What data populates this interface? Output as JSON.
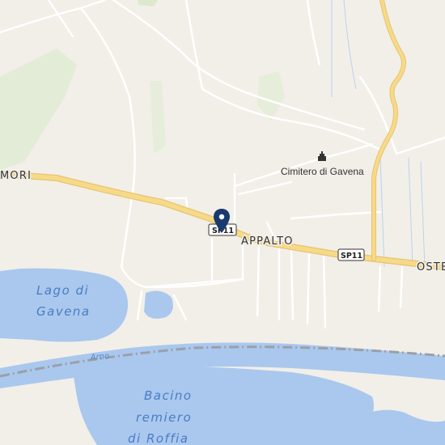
{
  "map": {
    "places": {
      "mori": "MORI",
      "appalto": "APPALTO",
      "osteria": "OSTE"
    },
    "poi": {
      "cemetery": "Cimitero di Gavena",
      "cemetery_icon": "cemetery-building-icon"
    },
    "shields": {
      "sp11_east": "SP11",
      "sp11_west": "SP11"
    },
    "water": {
      "lake_line1": "Lago di",
      "lake_line2": "Gavena",
      "river": "Arno",
      "basin_line1": "Bacino",
      "basin_line2": "remiero",
      "basin_line3": "di Roffia"
    },
    "marker": "location-pin-icon",
    "colors": {
      "land": "#f2efe9",
      "water": "#aac8ee",
      "green": "#d6e8c4",
      "road_major": "#f7d98a",
      "road_minor": "#ffffff",
      "railway": "#9aa0a8",
      "pin": "#1a3a6e"
    }
  }
}
